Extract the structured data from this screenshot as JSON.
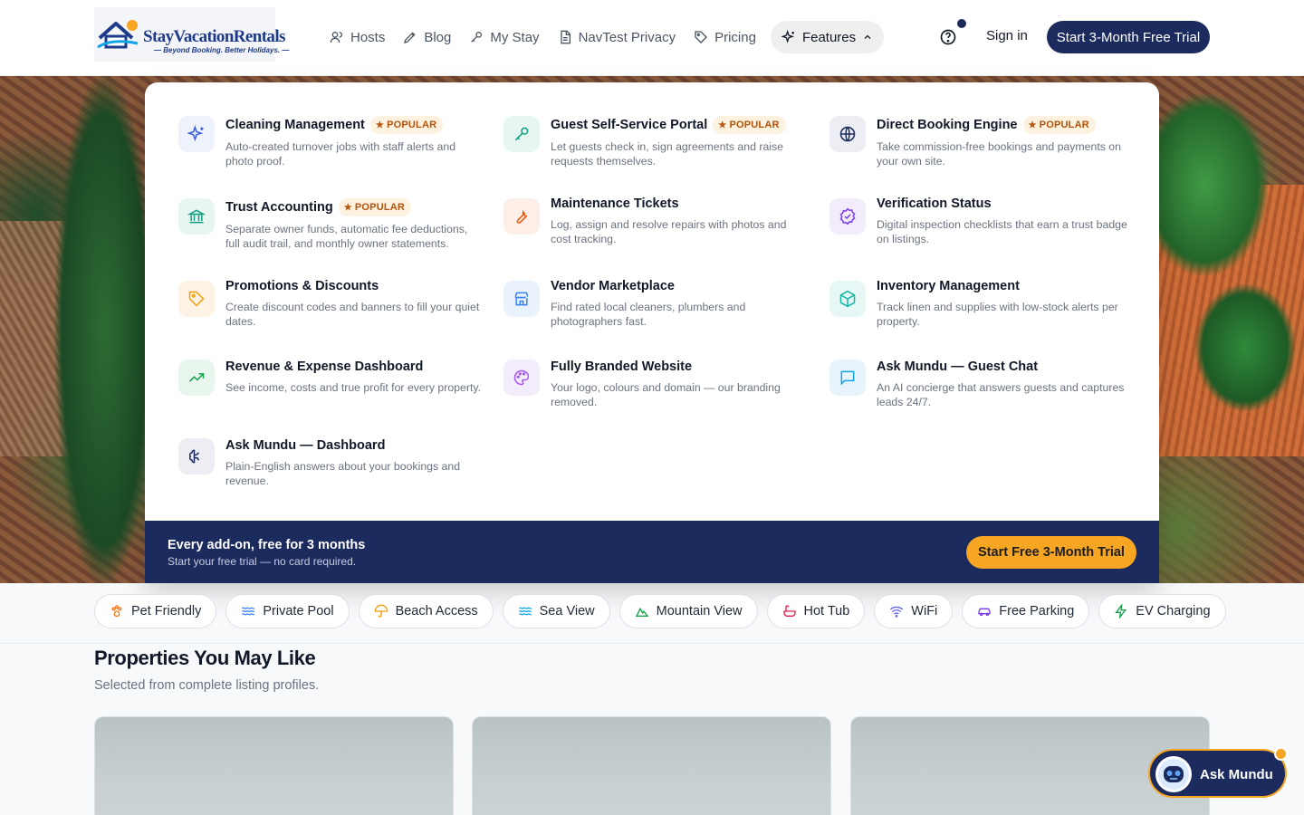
{
  "brand": {
    "name_part1": "Stay",
    "name_part2": "VacationRentals",
    "tagline": "— Beyond Booking. Better Holidays. —"
  },
  "nav": {
    "items": [
      {
        "label": "Hosts",
        "icon": "user-icon"
      },
      {
        "label": "Blog",
        "icon": "pen-nib-icon"
      },
      {
        "label": "My Stay",
        "icon": "key-icon"
      },
      {
        "label": "NavTest Privacy",
        "icon": "document-icon"
      },
      {
        "label": "Pricing",
        "icon": "tag-icon"
      },
      {
        "label": "Features",
        "icon": "sparkles-icon"
      }
    ],
    "signin": "Sign in",
    "trial": "Start 3-Month Free Trial"
  },
  "features": {
    "badge": "POPULAR",
    "items": [
      {
        "title": "Cleaning Management",
        "desc": "Auto-created turnover jobs with staff alerts and photo proof.",
        "popular": true
      },
      {
        "title": "Guest Self-Service Portal",
        "desc": "Let guests check in, sign agreements and raise requests themselves.",
        "popular": true
      },
      {
        "title": "Direct Booking Engine",
        "desc": "Take commission-free bookings and payments on your own site.",
        "popular": true
      },
      {
        "title": "Trust Accounting",
        "desc": "Separate owner funds, automatic fee deductions, full audit trail, and monthly owner statements.",
        "popular": true
      },
      {
        "title": "Maintenance Tickets",
        "desc": "Log, assign and resolve repairs with photos and cost tracking.",
        "popular": false
      },
      {
        "title": "Verification Status",
        "desc": "Digital inspection checklists that earn a trust badge on listings.",
        "popular": false
      },
      {
        "title": "Promotions & Discounts",
        "desc": "Create discount codes and banners to fill your quiet dates.",
        "popular": false
      },
      {
        "title": "Vendor Marketplace",
        "desc": "Find rated local cleaners, plumbers and photographers fast.",
        "popular": false
      },
      {
        "title": "Inventory Management",
        "desc": "Track linen and supplies with low-stock alerts per property.",
        "popular": false
      },
      {
        "title": "Revenue & Expense Dashboard",
        "desc": "See income, costs and true profit for every property.",
        "popular": false
      },
      {
        "title": "Fully Branded Website",
        "desc": "Your logo, colours and domain — our branding removed.",
        "popular": false
      },
      {
        "title": "Ask Mundu — Guest Chat",
        "desc": "An AI concierge that answers guests and captures leads 24/7.",
        "popular": false
      },
      {
        "title": "Ask Mundu — Dashboard",
        "desc": "Plain-English answers about your bookings and revenue.",
        "popular": false
      }
    ],
    "footer": {
      "heading": "Every add-on, free for 3 months",
      "sub": "Start your free trial — no card required.",
      "button": "Start Free 3-Month Trial"
    }
  },
  "chips": [
    {
      "label": "Pet Friendly",
      "icon": "paw-icon",
      "color": "#f97316"
    },
    {
      "label": "Private Pool",
      "icon": "waves-icon",
      "color": "#3b82f6"
    },
    {
      "label": "Beach Access",
      "icon": "umbrella-icon",
      "color": "#f59e0b"
    },
    {
      "label": "Sea View",
      "icon": "waves-icon",
      "color": "#0ea5e9"
    },
    {
      "label": "Mountain View",
      "icon": "mountain-icon",
      "color": "#16a34a"
    },
    {
      "label": "Hot Tub",
      "icon": "bath-icon",
      "color": "#e11d48"
    },
    {
      "label": "WiFi",
      "icon": "wifi-icon",
      "color": "#6366f1"
    },
    {
      "label": "Free Parking",
      "icon": "car-icon",
      "color": "#7c3aed"
    },
    {
      "label": "EV Charging",
      "icon": "bolt-icon",
      "color": "#16a34a"
    }
  ],
  "section": {
    "title": "Properties You May Like",
    "subtitle": "Selected from complete listing profiles."
  },
  "chat": {
    "label": "Ask Mundu"
  },
  "colors": {
    "navy": "#1c2b5e",
    "accent": "#f6a623",
    "popular_bg": "#fdf1e0",
    "popular_fg": "#b45309"
  }
}
